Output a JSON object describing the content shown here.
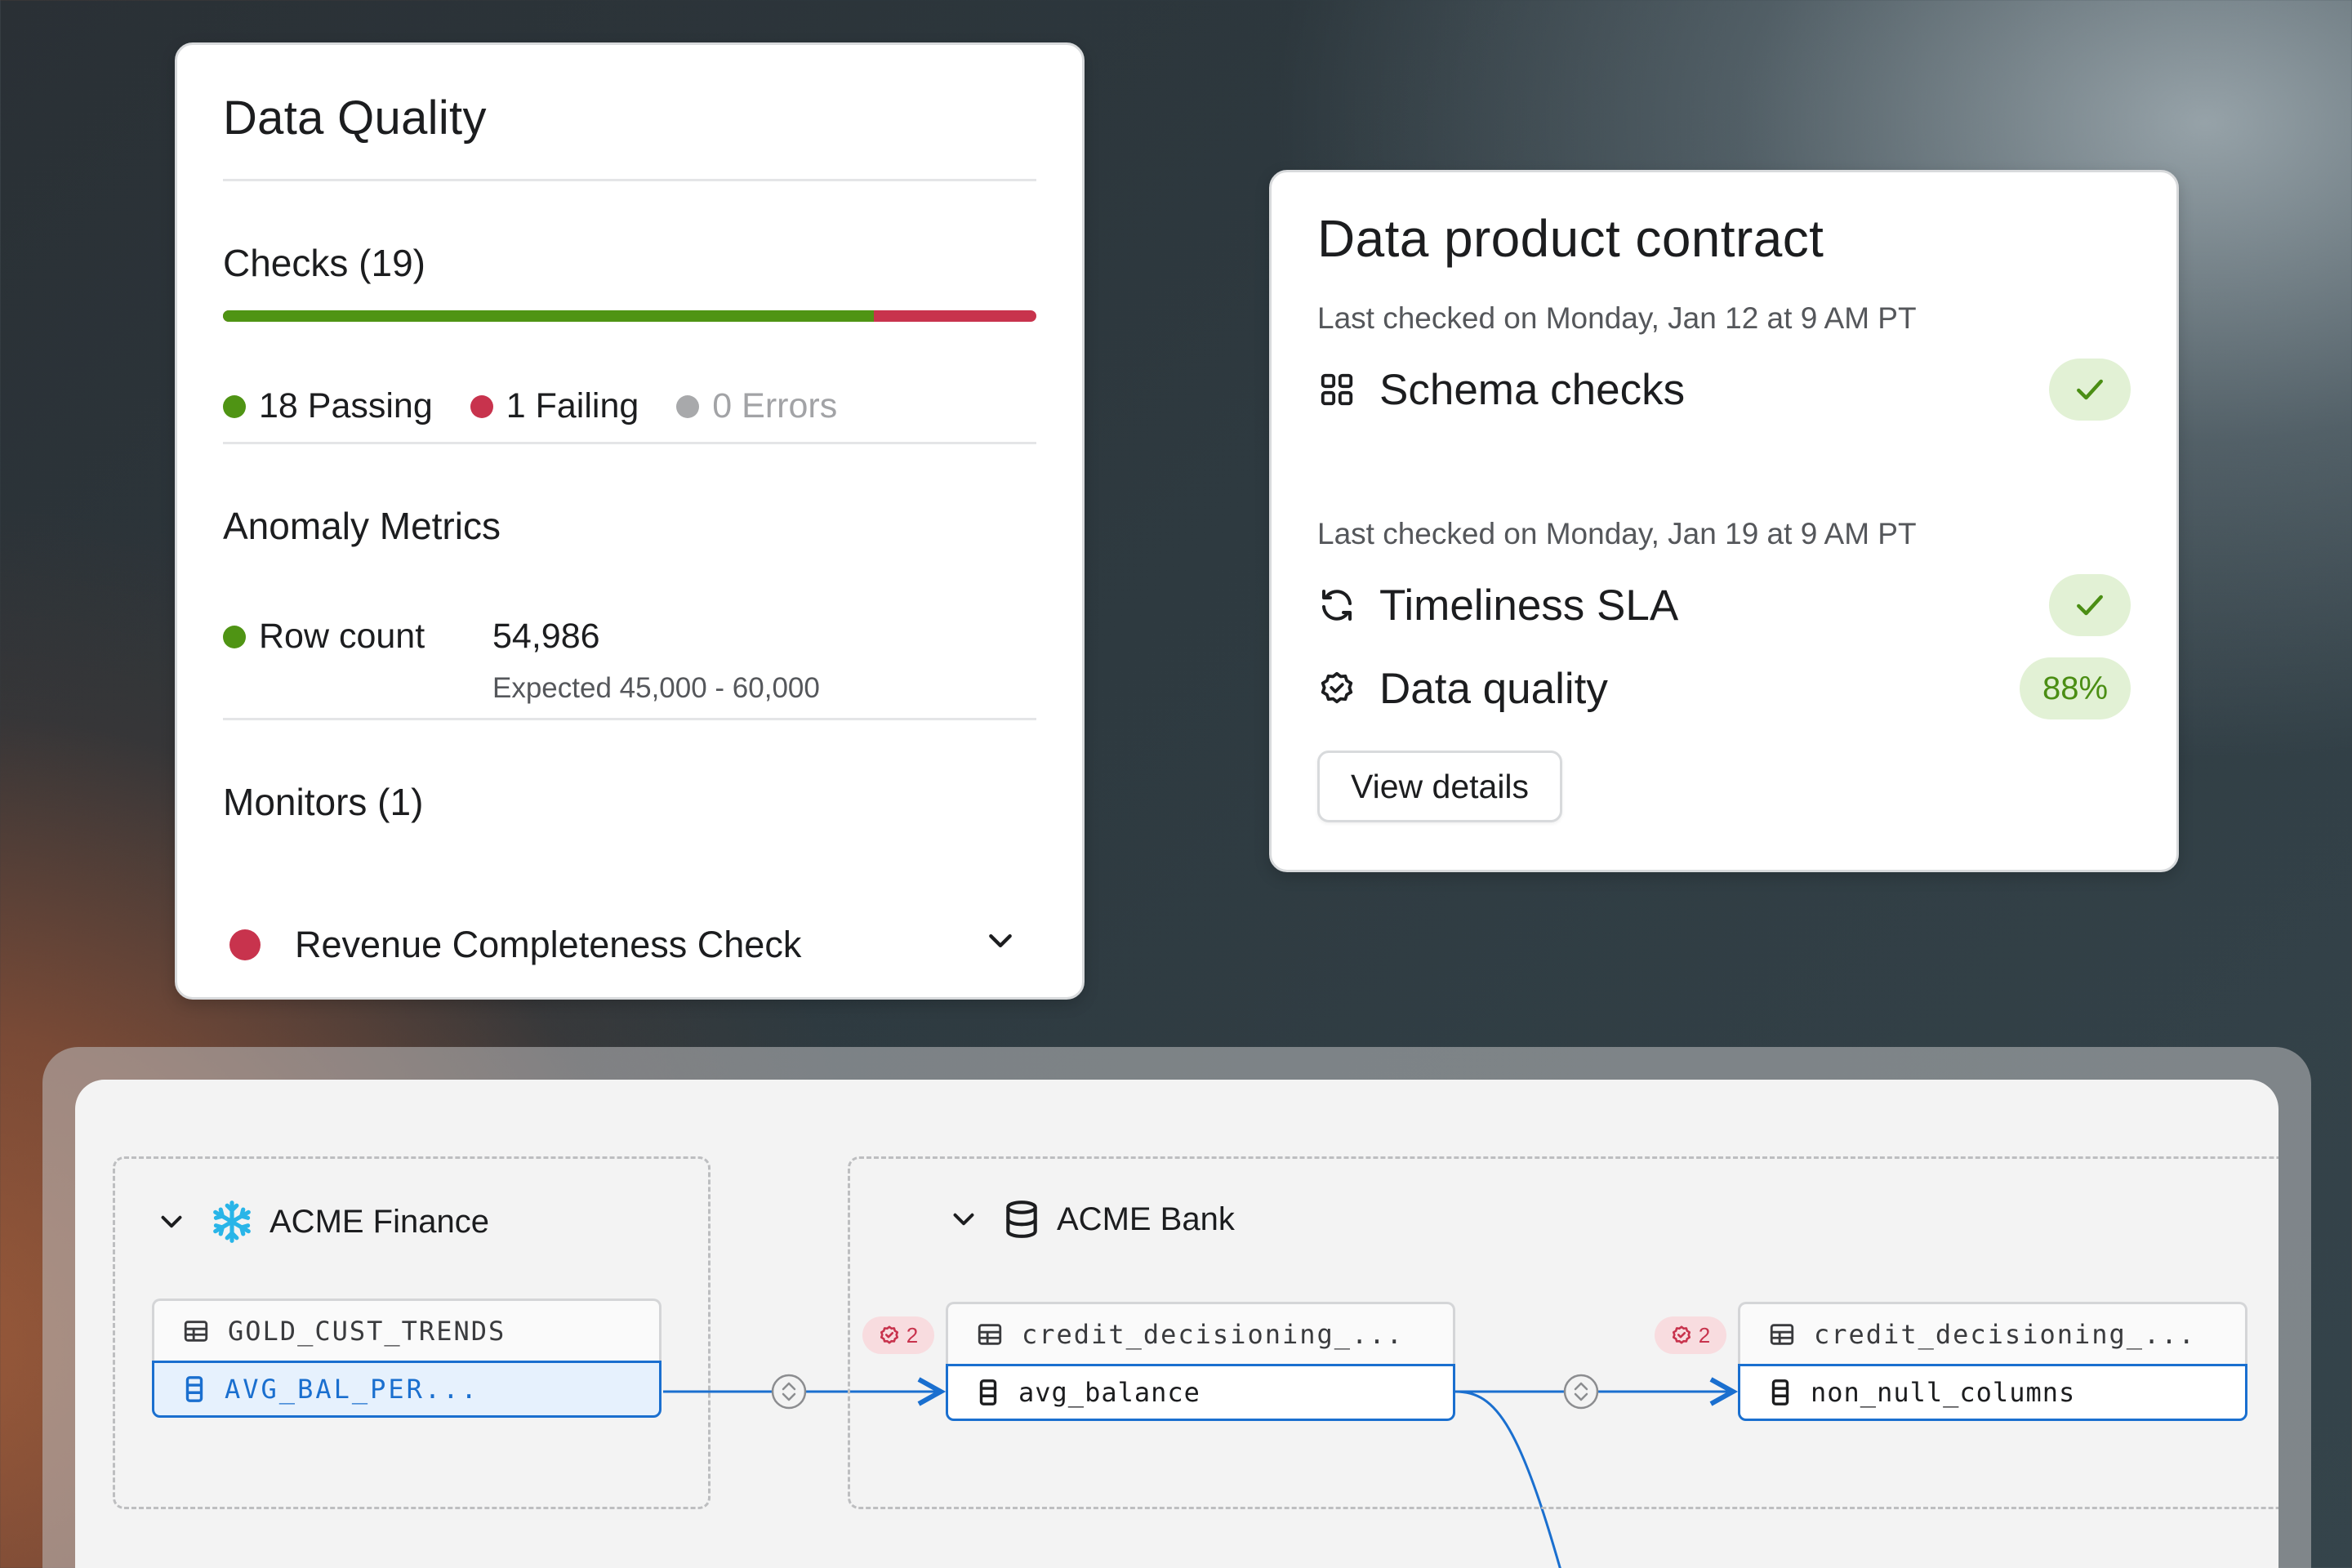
{
  "data_quality": {
    "title": "Data Quality",
    "checks": {
      "title": "Checks (19)",
      "passing_fraction": 0.8,
      "passing": "18 Passing",
      "failing": "1 Failing",
      "errors": "0 Errors"
    },
    "anomaly": {
      "title": "Anomaly Metrics",
      "metric_label": "Row count",
      "metric_value": "54,986",
      "expected": "Expected 45,000 - 60,000"
    },
    "monitors": {
      "title": "Monitors (1)",
      "items": [
        {
          "label": "Revenue Completeness Check"
        }
      ]
    }
  },
  "contract": {
    "title": "Data product contract",
    "schema_checked": "Last checked on Monday, Jan 12 at 9 AM PT",
    "schema_label": "Schema checks",
    "sla_checked": "Last checked on Monday, Jan 19 at 9 AM PT",
    "sla_label": "Timeliness SLA",
    "quality_label": "Data quality",
    "quality_value": "88%",
    "button": "View details"
  },
  "lineage": {
    "groups": [
      {
        "name": "ACME Finance",
        "icon": "snowflake-icon"
      },
      {
        "name": "ACME Bank",
        "icon": "database-icon"
      }
    ],
    "nodes": [
      {
        "table": "GOLD_CUST_TRENDS",
        "column": "AVG_BAL_PER..."
      },
      {
        "table": "credit_decisioning_...",
        "column": "avg_balance",
        "badge": "2"
      },
      {
        "table": "credit_decisioning_...",
        "column": "non_null_columns",
        "badge": "2"
      }
    ]
  },
  "colors": {
    "passing": "#4f9414",
    "failing": "#c8334d",
    "errors": "#a8a9ab",
    "link": "#1a6fcf",
    "pill_bg": "#e2f1d5"
  }
}
